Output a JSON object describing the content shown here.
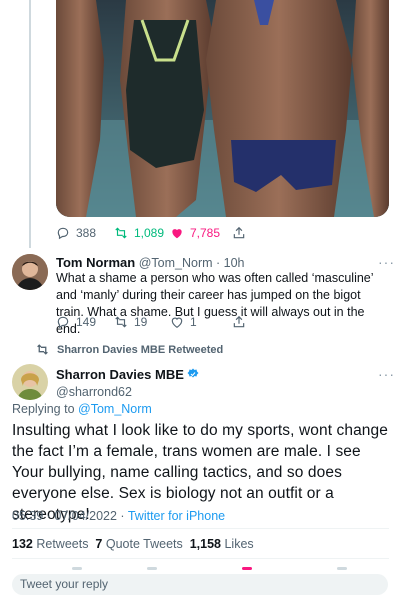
{
  "first_tweet": {
    "replies": "388",
    "retweets": "1,089",
    "likes": "7,785"
  },
  "reply_tweet": {
    "name": "Tom Norman",
    "handle": "@Tom_Norm",
    "time": "· 10h",
    "text": "What a shame a person who was often called ‘masculine’ and ‘manly’ during their career has jumped on the bigot train. What a shame. But I guess it will always out in the end.",
    "replies": "149",
    "retweets": "19",
    "likes": "1"
  },
  "retweet_banner": "Sharron Davies MBE Retweeted",
  "main_tweet": {
    "name": "Sharron Davies MBE",
    "handle": "@sharrond62",
    "replying_prefix": "Replying to ",
    "replying_to": "@Tom_Norm",
    "text": "Insulting what I look like to do my sports, wont change the fact I’m a female, trans women are male. I see Your bullying, name calling tactics, and so does everyone else. Sex is biology not an outfit or a stereotype!",
    "timestamp": "05:39 · 07/04/2022 · ",
    "source": "Twitter for iPhone",
    "retweets_count": "132",
    "retweets_label": "Retweets",
    "quote_count": "7",
    "quote_label": "Quote Tweets",
    "likes_count": "1,158",
    "likes_label": "Likes"
  },
  "reply_placeholder": "Tweet your reply",
  "colors": {
    "accent": "#1d9bf0",
    "retweet": "#00ba7c",
    "like": "#f91880",
    "muted": "#536471"
  }
}
